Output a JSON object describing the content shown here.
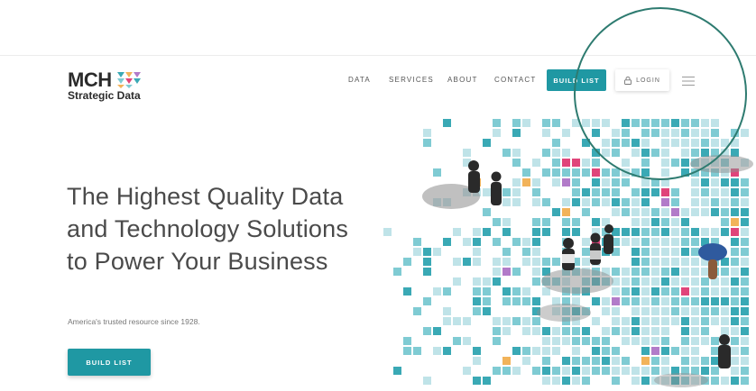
{
  "brand": {
    "logo_main": "MCH",
    "logo_sub": "Strategic Data"
  },
  "nav": {
    "items": [
      {
        "label": "DATA"
      },
      {
        "label": "SERVICES"
      },
      {
        "label": "ABOUT"
      },
      {
        "label": "CONTACT"
      }
    ],
    "build_list_label": "BUILD LIST",
    "login_label": "LOGIN"
  },
  "hero": {
    "title": "The Highest Quality Data and Technology Solutions to Power Your Business",
    "subtitle": "America's trusted resource since 1928.",
    "cta_label": "BUILD LIST"
  },
  "colors": {
    "accent": "#1f98a3",
    "annotation_circle": "#2e7b70",
    "tile_light": "#bfe3e8",
    "tile_mid": "#7fcbd3",
    "tile_dark": "#3aa9b5",
    "tile_pink": "#e0447a",
    "tile_orange": "#f2b35a",
    "tile_purple": "#b27bc9"
  },
  "icons": {
    "lock": "lock-icon",
    "menu": "hamburger-menu-icon"
  }
}
